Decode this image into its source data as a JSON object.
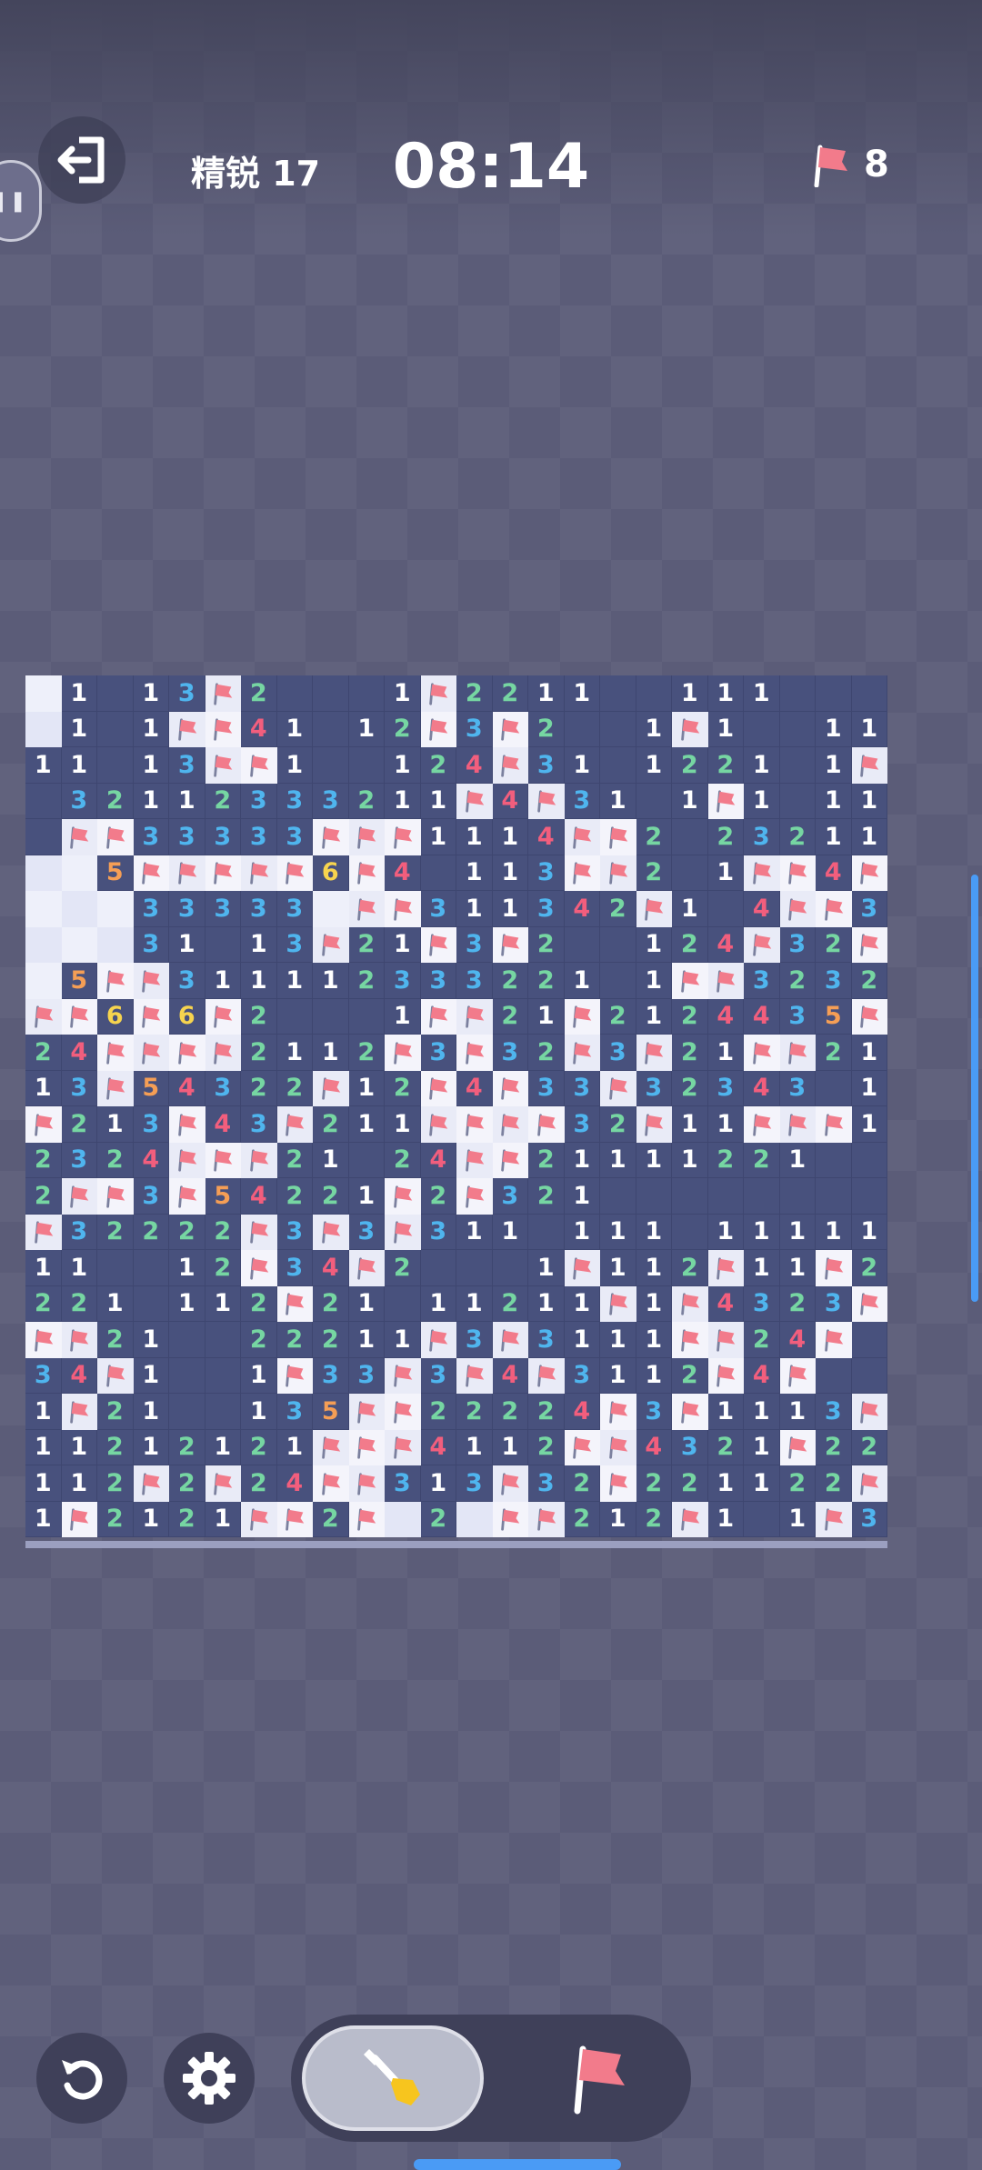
{
  "header": {
    "level_label": "精锐 17",
    "timer": "08:14",
    "flags_remaining": "8",
    "exit_icon": "exit-icon",
    "pause_icon": "pause-icon"
  },
  "board": {
    "columns": 24,
    "rows": 24,
    "legend": "u = unrevealed, o = revealed empty, f = flag, 1-6 = number",
    "grid": [
      "o1u13f2uuu1f2211uu111uuu",
      "o1u1ff41u12f3f2uu1f1uu11",
      "11u13ff1uu124f31u1221u1f",
      "u32112333211f4f31u1f1u11",
      "uff33333fff1114ff2u23211",
      "oo5fffff6f4u113ff2u1ff4f1",
      "ooo33333off311342f1u4ff32",
      "ooo31u13f21f3f2uu124f32f",
      "o5ff311112333221u1ff3232",
      "ff6f6f2uuu1ff21f2124435f2f",
      "24ffff2112f3f32f3f21ff2121",
      "13f54322f12f4f33f32343u1",
      "f213f43f211ffff32f11fff1",
      "2324fff21u24ff21111221uu",
      "2ff3f54221f2f321uuuuuuuu",
      "f32222f3f3f311u111u111111",
      "11uu12f34f2uuu1f112f11f2",
      "221u112f21u11211f1f4323f",
      "ff21uu22211f3f3111ff24f",
      "34f1uu1f33f3f4f3112f4f",
      "1f21uu135ff22224f3f1113f31",
      "11212121fff4112ff4321f2232",
      "112f2f24ff313f32f221122ff",
      "1f2121ff2fo2off212f1u1f32"
    ]
  }
}
